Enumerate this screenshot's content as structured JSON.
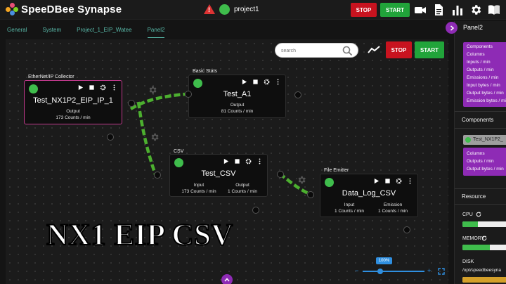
{
  "app": {
    "title": "SpeeDBee Synapse",
    "project": "project1"
  },
  "toolbar": {
    "stop_label": "STOP",
    "start_label": "START",
    "icons": [
      "video-camera-icon",
      "document-icon",
      "bar-chart-icon",
      "gear-icon",
      "book-icon"
    ]
  },
  "tabs": [
    {
      "label": "General",
      "active": false
    },
    {
      "label": "System",
      "active": false
    },
    {
      "label": "Project_1_EIP_Watee",
      "active": false
    },
    {
      "label": "Panel2",
      "active": true
    }
  ],
  "canvas": {
    "search_placeholder": "search",
    "stop_label": "STOP",
    "start_label": "START",
    "zoom": "100%",
    "zoom_level": 0.28
  },
  "nodes": {
    "eip": {
      "type": "EtherNet/IP Collector",
      "title": "Test_NX1P2_EIP_IP_1",
      "output_label": "Output",
      "output_value": "173 Counts / min"
    },
    "stats": {
      "type": "Basic Stats",
      "title": "Test_A1",
      "output_label": "Output",
      "output_value": "81 Counts / min"
    },
    "csv": {
      "type": "CSV",
      "title": "Test_CSV",
      "input_label": "Input",
      "input_value": "173 Counts / min",
      "output_label": "Output",
      "output_value": "1 Counts / min"
    },
    "emitter": {
      "type": "File Emitter",
      "title": "Data_Log_CSV",
      "input_label": "Input",
      "input_value": "1 Counts / min",
      "emission_label": "Emission",
      "emission_value": "1 Counts / min"
    }
  },
  "overlay_caption": "NX1 EIP CSV",
  "panel": {
    "title": "Panel2",
    "metrics": [
      "Components",
      "Columns",
      "Inputs / min",
      "Outputs / min",
      "Emissions / min",
      "Input bytes / min",
      "Output bytes / min",
      "Emission bytes / min"
    ],
    "components_title": "Components",
    "component_card": "Test_NX1P2_",
    "component_metrics": [
      "Columns",
      "Outputs / min",
      "Output bytes / min"
    ],
    "resource_title": "Resource",
    "cpu_label": "CPU",
    "cpu_usage": 0.32,
    "memory_label": "MEMORY",
    "memory_usage": 0.55,
    "disk_label": "DISK",
    "disk_path": "/opt/speedbeesyna",
    "disk_usage": 0.9
  },
  "colors": {
    "accent_purple": "#8e2bb5",
    "status_green": "#3fbd4c",
    "stop_red": "#c8131f",
    "start_green": "#21a43a",
    "tab_teal": "#58b8a8",
    "connection_green": "#4caf2f",
    "zoom_blue": "#2f8fe0"
  }
}
